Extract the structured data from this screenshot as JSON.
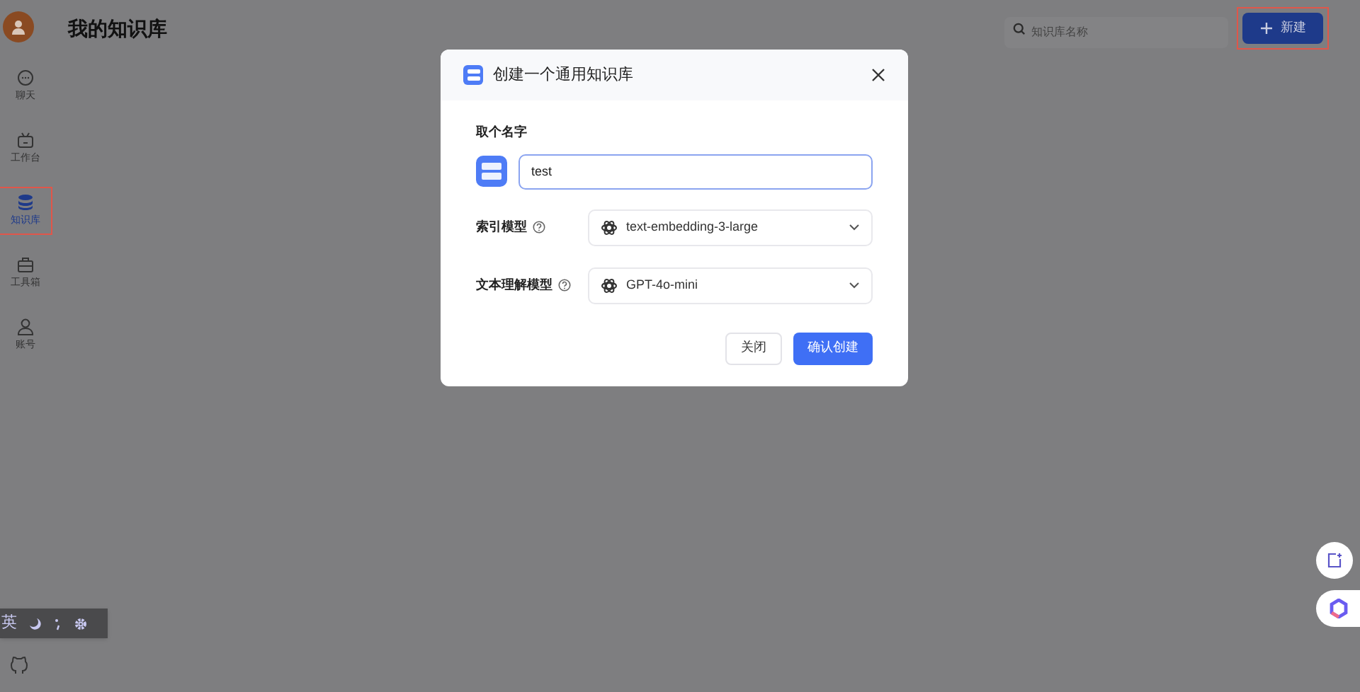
{
  "sidebar": {
    "items": [
      {
        "label": "聊天",
        "kind": "chat",
        "selected": false,
        "highlighted": false
      },
      {
        "label": "工作台",
        "kind": "robot",
        "selected": false,
        "highlighted": false
      },
      {
        "label": "知识库",
        "kind": "database",
        "selected": true,
        "highlighted": true
      },
      {
        "label": "工具箱",
        "kind": "toolbox",
        "selected": false,
        "highlighted": false
      },
      {
        "label": "账号",
        "kind": "user",
        "selected": false,
        "highlighted": false
      }
    ]
  },
  "header": {
    "title": "我的知识库",
    "search": {
      "placeholder": "知识库名称"
    },
    "new_button": {
      "label": "新建",
      "highlighted": true
    }
  },
  "ime_toolbar": {
    "label": "英"
  },
  "dialog": {
    "title": "创建一个通用知识库",
    "name_label": "取个名字",
    "name_value": "test",
    "fields": [
      {
        "label": "索引模型",
        "value": "text-embedding-3-large"
      },
      {
        "label": "文本理解模型",
        "value": "GPT-4o-mini"
      }
    ],
    "buttons": [
      {
        "label": "关闭",
        "kind": "secondary"
      },
      {
        "label": "确认创建",
        "kind": "primary"
      }
    ]
  }
}
